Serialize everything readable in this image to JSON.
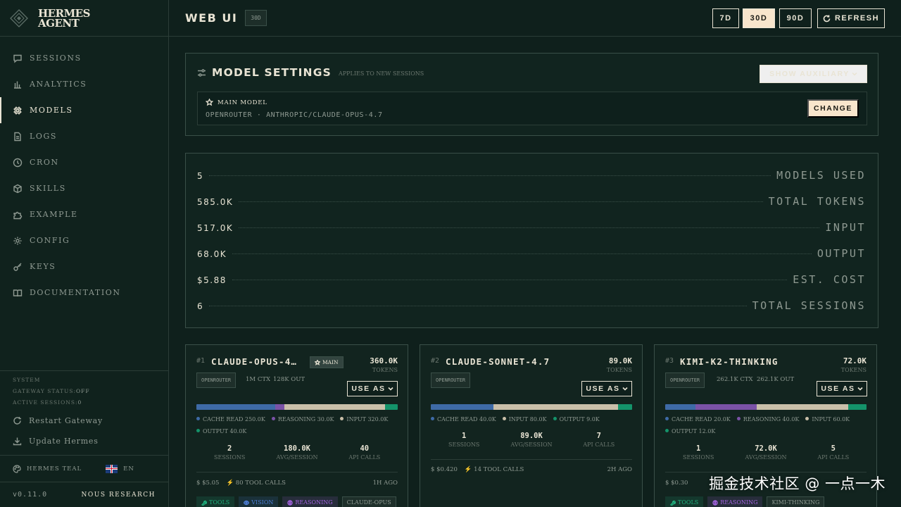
{
  "app": {
    "name": "HERMES AGENT",
    "version": "v0.11.0",
    "org": "NOUS RESEARCH"
  },
  "sidebar": {
    "items": [
      {
        "label": "SESSIONS",
        "icon": "chat-icon"
      },
      {
        "label": "ANALYTICS",
        "icon": "bar-chart-icon"
      },
      {
        "label": "MODELS",
        "icon": "chip-icon",
        "active": true
      },
      {
        "label": "LOGS",
        "icon": "file-icon"
      },
      {
        "label": "CRON",
        "icon": "clock-icon"
      },
      {
        "label": "SKILLS",
        "icon": "package-icon"
      },
      {
        "label": "EXAMPLE",
        "icon": "puzzle-icon"
      },
      {
        "label": "CONFIG",
        "icon": "gear-icon"
      },
      {
        "label": "KEYS",
        "icon": "key-icon"
      },
      {
        "label": "DOCUMENTATION",
        "icon": "book-icon"
      }
    ],
    "system": {
      "heading": "SYSTEM",
      "gateway_label": "GATEWAY STATUS:",
      "gateway_value": "OFF",
      "sessions_label": "ACTIVE SESSIONS:",
      "sessions_value": "0",
      "restart": "Restart Gateway",
      "update": "Update Hermes"
    },
    "theme": "HERMES TEAL",
    "language": "EN"
  },
  "header": {
    "title": "WEB UI",
    "badge": "30D",
    "ranges": [
      "7D",
      "30D",
      "90D"
    ],
    "active_range": "30D",
    "refresh": "REFRESH"
  },
  "settings": {
    "title": "MODEL SETTINGS",
    "subtitle": "APPLIES TO NEW SESSIONS",
    "show_auxiliary": "SHOW AUXILIARY",
    "main_model_label": "MAIN MODEL",
    "main_model_value": "OPENROUTER · ANTHROPIC/CLAUDE-OPUS-4.7",
    "change": "CHANGE"
  },
  "stats": [
    {
      "value": "5",
      "label": "MODELS USED"
    },
    {
      "value": "585.0K",
      "label": "TOTAL TOKENS"
    },
    {
      "value": "517.0K",
      "label": "INPUT"
    },
    {
      "value": "68.0K",
      "label": "OUTPUT"
    },
    {
      "value": "$5.88",
      "label": "EST. COST"
    },
    {
      "value": "6",
      "label": "TOTAL SESSIONS"
    }
  ],
  "colors": {
    "cache": "#3e6aa6",
    "reasoning": "#7a52a6",
    "input": "#c9bfa9",
    "output": "#14936a",
    "accent": "#f8e5cc"
  },
  "cards": [
    {
      "rank": "#1",
      "name": "CLAUDE-OPUS-4…",
      "main_badge": "MAIN",
      "tokens": "360.0K",
      "tokens_unit": "TOKENS",
      "provider": "OPENROUTER",
      "ctx": "1M CTX",
      "out": "128K OUT",
      "use_as": "USE AS",
      "segments": [
        {
          "kind": "cache",
          "label": "CACHE READ 250.0K",
          "value": 250.0
        },
        {
          "kind": "reasoning",
          "label": "REASONING 30.0K",
          "value": 30.0
        },
        {
          "kind": "input",
          "label": "INPUT 320.0K",
          "value": 320.0
        },
        {
          "kind": "output",
          "label": "OUTPUT 40.0K",
          "value": 40.0
        }
      ],
      "sessions": "2",
      "avg": "180.0K",
      "api_calls": "40",
      "sessions_unit": "SESSIONS",
      "avg_unit": "AVG/SESSION",
      "api_unit": "API CALLS",
      "cost": "$ $5.05",
      "tool_calls": "80 TOOL CALLS",
      "ago": "1H AGO",
      "caps": [
        {
          "label": "TOOLS",
          "color": "#1fb07d",
          "icon": "wrench-icon"
        },
        {
          "label": "VISION",
          "color": "#4d7ed6",
          "icon": "eye-icon"
        },
        {
          "label": "REASONING",
          "color": "#a463e0",
          "icon": "brain-icon"
        },
        {
          "label": "CLAUDE-OPUS",
          "color": "#8f9a92",
          "icon": ""
        }
      ]
    },
    {
      "rank": "#2",
      "name": "CLAUDE-SONNET-4.7",
      "tokens": "89.0K",
      "tokens_unit": "TOKENS",
      "provider": "OPENROUTER",
      "ctx": "",
      "out": "",
      "use_as": "USE AS",
      "segments": [
        {
          "kind": "cache",
          "label": "CACHE READ 40.0K",
          "value": 40.0
        },
        {
          "kind": "input",
          "label": "INPUT 80.0K",
          "value": 80.0
        },
        {
          "kind": "output",
          "label": "OUTPUT 9.0K",
          "value": 9.0
        }
      ],
      "sessions": "1",
      "avg": "89.0K",
      "api_calls": "7",
      "sessions_unit": "SESSIONS",
      "avg_unit": "AVG/SESSION",
      "api_unit": "API CALLS",
      "cost": "$ $0.420",
      "tool_calls": "14 TOOL CALLS",
      "ago": "2H AGO",
      "caps": []
    },
    {
      "rank": "#3",
      "name": "KIMI-K2-THINKING",
      "tokens": "72.0K",
      "tokens_unit": "TOKENS",
      "provider": "OPENROUTER",
      "ctx": "262.1K CTX",
      "out": "262.1K OUT",
      "use_as": "USE AS",
      "segments": [
        {
          "kind": "cache",
          "label": "CACHE READ 20.0K",
          "value": 20.0
        },
        {
          "kind": "reasoning",
          "label": "REASONING 40.0K",
          "value": 40.0
        },
        {
          "kind": "input",
          "label": "INPUT 60.0K",
          "value": 60.0
        },
        {
          "kind": "output",
          "label": "OUTPUT 12.0K",
          "value": 12.0
        }
      ],
      "sessions": "1",
      "avg": "72.0K",
      "api_calls": "5",
      "sessions_unit": "SESSIONS",
      "avg_unit": "AVG/SESSION",
      "api_unit": "API CALLS",
      "cost": "$ $0.30",
      "tool_calls": "",
      "ago": "",
      "caps": [
        {
          "label": "TOOLS",
          "color": "#1fb07d",
          "icon": "wrench-icon"
        },
        {
          "label": "REASONING",
          "color": "#a463e0",
          "icon": "brain-icon"
        },
        {
          "label": "KIMI-THINKING",
          "color": "#8f9a92",
          "icon": ""
        }
      ]
    }
  ],
  "watermark": "掘金技术社区 @ 一点一木"
}
